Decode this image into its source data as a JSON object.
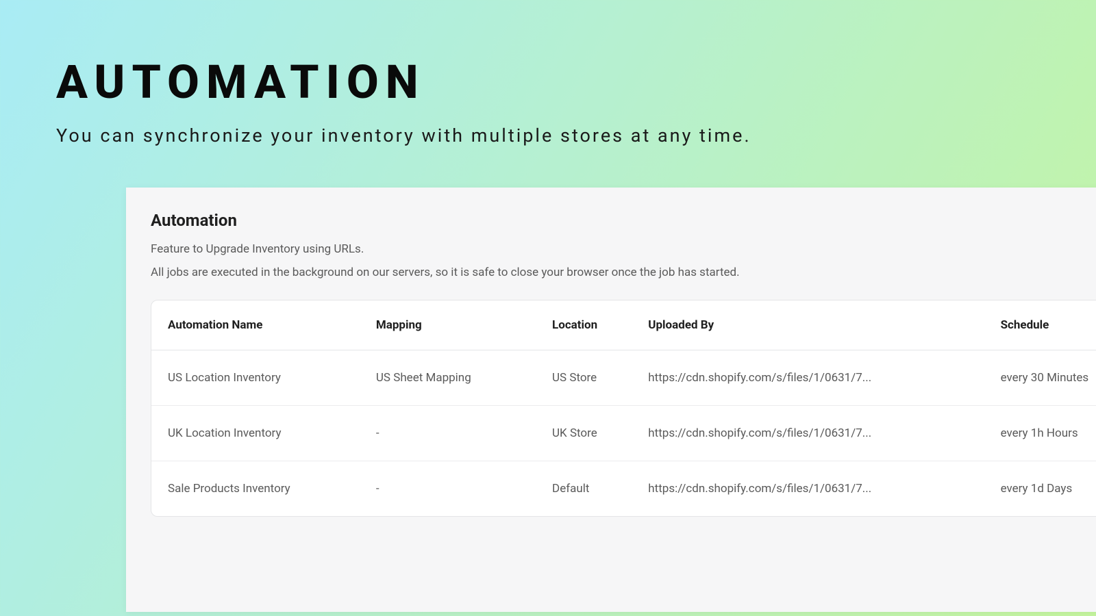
{
  "hero": {
    "title": "AUTOMATION",
    "subtitle": "You can synchronize your inventory with multiple stores at any time."
  },
  "panel": {
    "title": "Automation",
    "description": "Feature to Upgrade Inventory using URLs.",
    "note": "All jobs are executed in the background on our servers, so it is safe to close your browser once the job has started."
  },
  "table": {
    "headers": {
      "name": "Automation Name",
      "mapping": "Mapping",
      "location": "Location",
      "uploaded": "Uploaded By",
      "schedule": "Schedule"
    },
    "rows": [
      {
        "name": "US Location Inventory",
        "mapping": "US Sheet Mapping",
        "location": "US Store",
        "uploaded": "https://cdn.shopify.com/s/files/1/0631/7...",
        "schedule": "every 30 Minutes"
      },
      {
        "name": "UK Location Inventory",
        "mapping": "-",
        "location": "UK Store",
        "uploaded": "https://cdn.shopify.com/s/files/1/0631/7...",
        "schedule": "every 1h Hours"
      },
      {
        "name": "Sale Products Inventory",
        "mapping": "-",
        "location": "Default",
        "uploaded": "https://cdn.shopify.com/s/files/1/0631/7...",
        "schedule": "every 1d Days"
      }
    ]
  }
}
